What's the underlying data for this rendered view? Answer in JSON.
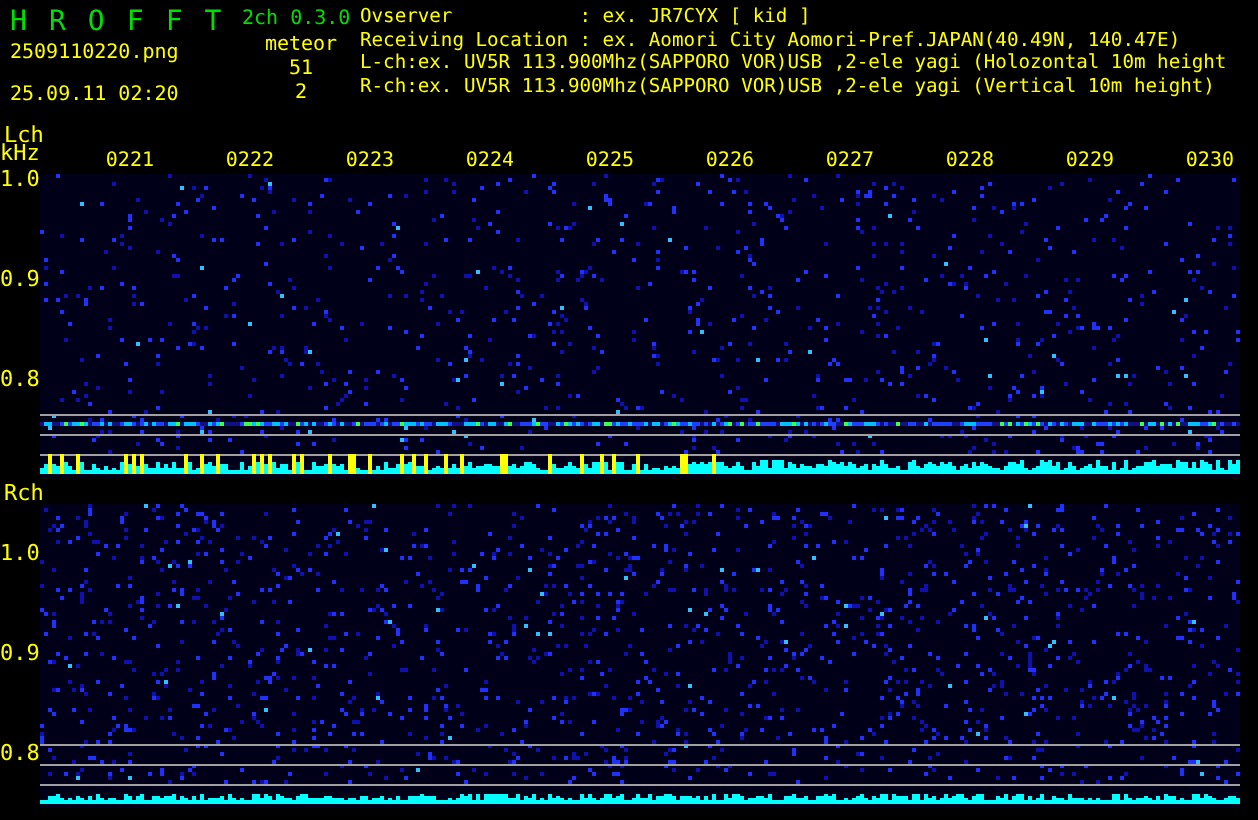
{
  "header": {
    "app_name": "H R O F F T",
    "version": "2ch 0.3.0",
    "filename": "2509110220.png",
    "mode": "meteor",
    "datetime": "25.09.11 02:20",
    "counts": [
      "51",
      "2"
    ],
    "info_lines": [
      "Ovserver           : ex. JR7CYX [ kid ]",
      "Receiving Location : ex. Aomori City Aomori-Pref.JAPAN(40.49N, 140.47E)",
      "L-ch:ex. UV5R 113.900Mhz(SAPPORO VOR)USB ,2-ele yagi (Holozontal 10m height",
      "R-ch:ex. UV5R 113.900Mhz(SAPPORO VOR)USB ,2-ele yagi (Vertical 10m height)"
    ]
  },
  "time_axis": [
    "0221",
    "0222",
    "0223",
    "0224",
    "0225",
    "0226",
    "0227",
    "0228",
    "0229",
    "0230"
  ],
  "channels": [
    {
      "name": "Lch",
      "unit": "kHz",
      "ticks": [
        "1.0",
        "0.9",
        "0.8"
      ]
    },
    {
      "name": "Rch",
      "ticks": [
        "1.0",
        "0.9",
        "0.8"
      ]
    }
  ]
}
